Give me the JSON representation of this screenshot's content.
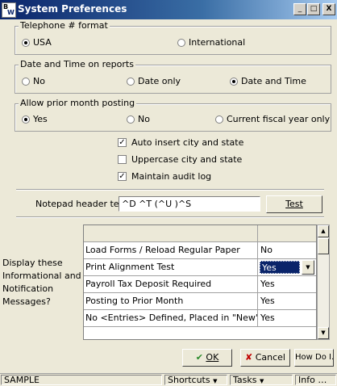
{
  "window": {
    "title": "System Preferences",
    "icon_letters": [
      "B",
      "W"
    ],
    "minimize_glyph": "_",
    "maximize_glyph": "□",
    "close_glyph": "X"
  },
  "telephone": {
    "label": "Telephone # format",
    "options": [
      "USA",
      "International"
    ],
    "selected": "USA"
  },
  "datetime": {
    "label": "Date and Time on reports",
    "options": [
      "No",
      "Date only",
      "Date and Time"
    ],
    "selected": "Date and Time"
  },
  "prior_month": {
    "label": "Allow prior month posting",
    "options": [
      "Yes",
      "No",
      "Current fiscal year only"
    ],
    "selected": "Yes"
  },
  "checkboxes": [
    {
      "label": "Auto insert city and state",
      "checked": true
    },
    {
      "label": "Uppercase city and state",
      "checked": false
    },
    {
      "label": "Maintain audit log",
      "checked": true
    }
  ],
  "notepad": {
    "label": "Notepad header text",
    "value": "^D ^T (^U )^S",
    "test_button": "Test"
  },
  "messages": {
    "label_lines": [
      "Display these",
      "Informational and",
      "Notification",
      "Messages?"
    ],
    "rows": [
      {
        "name": "Load Forms / Reload Regular Paper",
        "value": "No"
      },
      {
        "name": "Print Alignment Test",
        "value": "Yes"
      },
      {
        "name": "Payroll Tax Deposit Required",
        "value": "Yes"
      },
      {
        "name": "Posting to Prior Month",
        "value": "Yes"
      },
      {
        "name": "No <Entries> Defined, Placed in \"New\" Mode",
        "value": "Yes"
      }
    ]
  },
  "buttons": {
    "ok": "OK",
    "cancel": "Cancel",
    "howdoi": "How Do I..."
  },
  "statusbar": {
    "company": "SAMPLE",
    "shortcuts": "Shortcuts",
    "tasks": "Tasks",
    "info": "Info"
  },
  "colors": {
    "title_active": "#0a246a",
    "ok_check": "#2a8a2a",
    "cancel_x": "#c00000"
  }
}
